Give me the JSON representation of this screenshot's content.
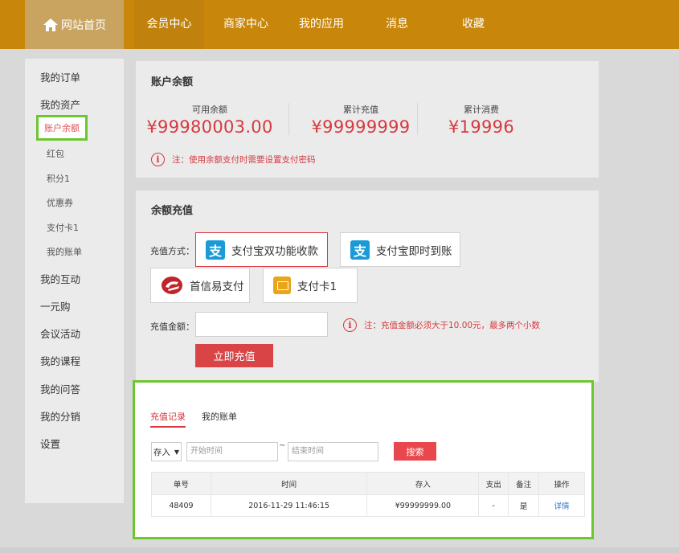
{
  "nav": {
    "home_label": "网站首页",
    "items": [
      "会员中心",
      "商家中心",
      "我的应用",
      "消息",
      "收藏"
    ]
  },
  "sidebar": {
    "items": [
      {
        "label": "我的订单"
      },
      {
        "label": "我的资产"
      },
      {
        "label": "账户余额"
      },
      {
        "label": "红包"
      },
      {
        "label": "积分1"
      },
      {
        "label": "优惠券"
      },
      {
        "label": "支付卡1"
      },
      {
        "label": "我的账单"
      },
      {
        "label": "我的互动"
      },
      {
        "label": "一元购"
      },
      {
        "label": "会议活动"
      },
      {
        "label": "我的课程"
      },
      {
        "label": "我的问答"
      },
      {
        "label": "我的分销"
      },
      {
        "label": "设置"
      }
    ]
  },
  "balance": {
    "title": "账户余额",
    "stats": [
      {
        "label": "可用余额",
        "value": "¥99980003.00"
      },
      {
        "label": "累计充值",
        "value": "¥99999999"
      },
      {
        "label": "累计消费",
        "value": "¥19996"
      }
    ],
    "note": "注：使用余额支付时需要设置支付密码",
    "accent_color": "#d6393f"
  },
  "recharge": {
    "title": "余额充值",
    "method_label": "充值方式：",
    "methods": [
      "支付宝双功能收款",
      "支付宝即时到账",
      "首信易支付",
      "支付卡1"
    ],
    "amount_label": "充值金额：",
    "amount_value": "",
    "note": "注：充值金额必须大于10.00元，最多两个小数",
    "submit_label": "立即充值"
  },
  "records": {
    "tabs": [
      "充值记录",
      "我的账单"
    ],
    "filter": {
      "select_value": "存入",
      "start_placeholder": "开始时间",
      "end_placeholder": "结束时间",
      "separator": "~",
      "search_label": "搜索"
    },
    "columns": [
      "单号",
      "时间",
      "存入",
      "支出",
      "备注",
      "操作"
    ],
    "rows": [
      {
        "id": "48409",
        "time": "2016-11-29 11:46:15",
        "deposit": "¥99999999.00",
        "expense": "-",
        "remark": "是",
        "action": "详情"
      }
    ]
  }
}
